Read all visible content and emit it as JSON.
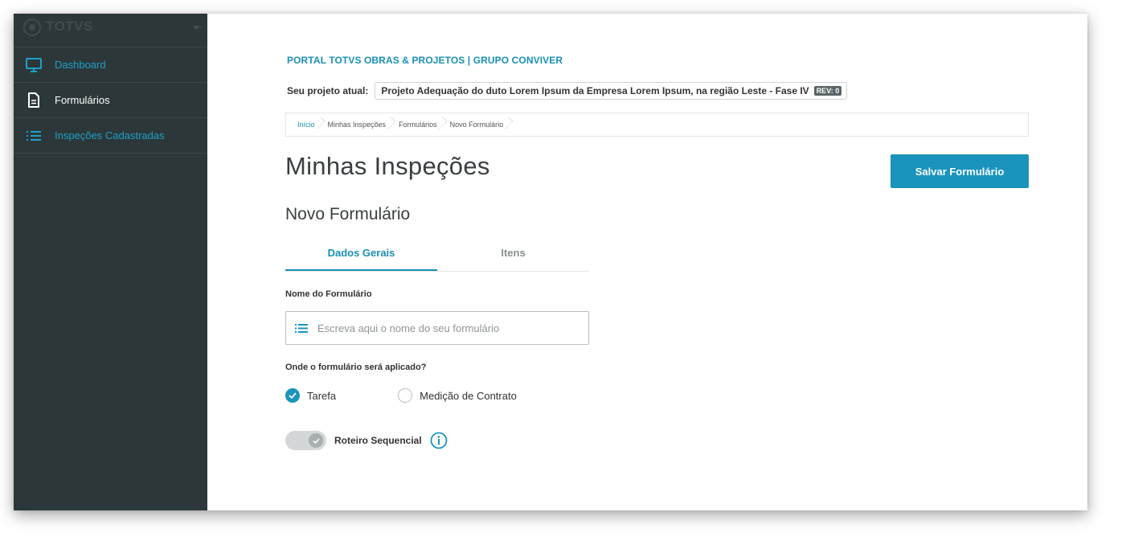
{
  "sidebar": {
    "brand": "TOTVS",
    "items": [
      {
        "label": "Dashboard",
        "icon": "monitor-icon"
      },
      {
        "label": "Formulários",
        "icon": "document-icon"
      },
      {
        "label": "Inspeções Cadastradas",
        "icon": "list-icon"
      }
    ]
  },
  "header": {
    "portal_title": "PORTAL TOTVS OBRAS & PROJETOS | GRUPO CONVIVER",
    "project_label": "Seu projeto atual:",
    "project_name": "Projeto Adequação do duto Lorem Ipsum da Empresa Lorem Ipsum, na região Leste - Fase IV",
    "revision": "REV: 0"
  },
  "breadcrumb": [
    "Início",
    "Minhas Inspeções",
    "Formulários",
    "Novo Formulário"
  ],
  "page": {
    "title": "Minhas Inspeções",
    "save_label": "Salvar Formulário",
    "subtitle": "Novo Formulário"
  },
  "tabs": [
    "Dados Gerais",
    "Itens"
  ],
  "form": {
    "name_label": "Nome do Formulário",
    "name_placeholder": "Escreva aqui o nome do seu formulário",
    "name_value": "",
    "apply_question": "Onde o formulário será aplicado?",
    "options": [
      "Tarefa",
      "Medição de Contrato"
    ],
    "selected_option": "Tarefa",
    "toggle_label": "Roteiro Sequencial"
  },
  "colors": {
    "accent": "#1a94bd",
    "sidebar_bg": "#2c3739"
  }
}
